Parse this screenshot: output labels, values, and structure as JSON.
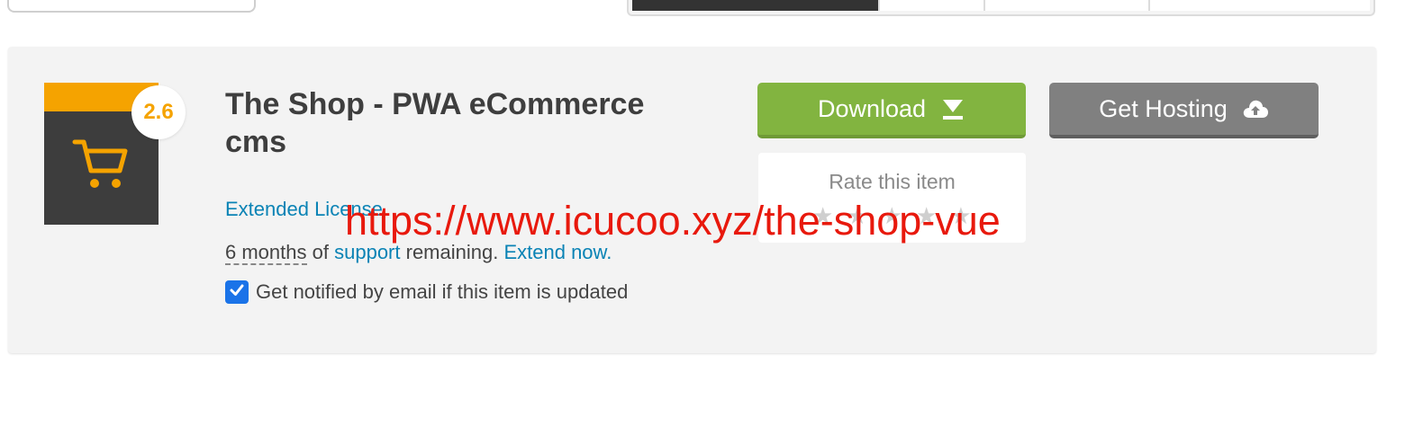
{
  "item": {
    "rating": "2.6",
    "title": "The Shop - PWA eCommerce cms",
    "license": "Extended License",
    "support": {
      "months": "6 months",
      "of": "of",
      "support_link": "support",
      "remaining": "remaining.",
      "extend_link": "Extend now."
    },
    "notify": {
      "checked": true,
      "label": "Get notified by email if this item is updated"
    }
  },
  "actions": {
    "download_label": "Download",
    "hosting_label": "Get Hosting"
  },
  "rating_widget": {
    "label": "Rate this item",
    "stars": 5
  },
  "watermark": "https://www.icucoo.xyz/the-shop-vue",
  "colors": {
    "accent_green": "#82b440",
    "button_gray": "#808080",
    "link_blue": "#0a83b5",
    "thumb_orange": "#f5a300",
    "watermark_red": "#e8190d"
  },
  "icons": {
    "cart": "shopping-cart-icon",
    "download": "download-arrow-icon",
    "hosting": "cloud-upload-icon",
    "checkbox": "checkmark-icon",
    "star": "star-icon"
  }
}
